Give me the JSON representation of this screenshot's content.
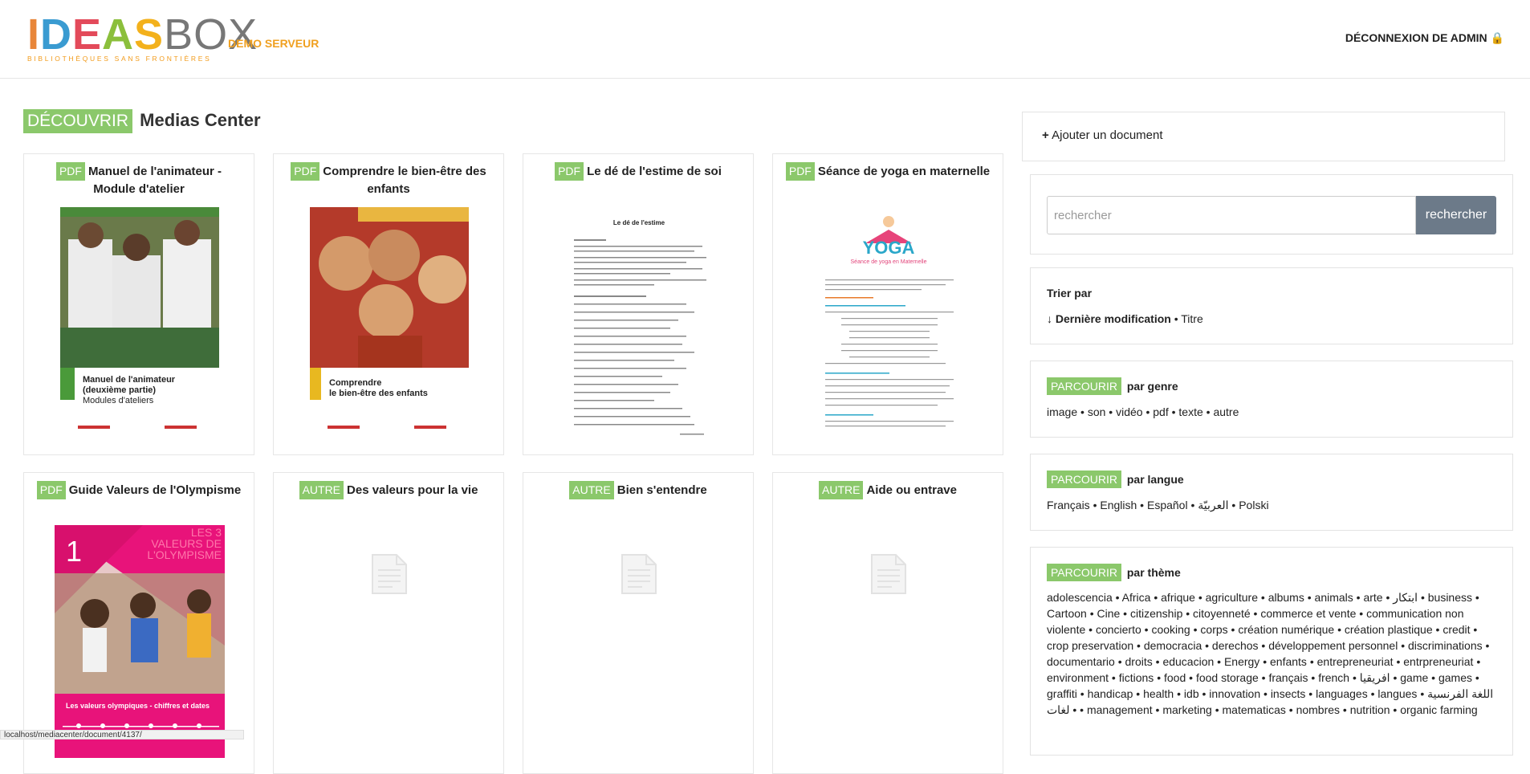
{
  "header": {
    "logo_letters": [
      "I",
      "D",
      "E",
      "A",
      "S"
    ],
    "logo_box": "BOX",
    "logo_tagline": "BIBLIOTHÈQUES SANS FRONTIÈRES",
    "server_name": "DEMO SERVEUR",
    "logout_label": "DÉCONNEXION DE ADMIN",
    "logout_icon": "lock-icon"
  },
  "page": {
    "tag": "DÉCOUVRIR",
    "title": "Medias Center"
  },
  "cards": [
    {
      "type": "PDF",
      "title": "Manuel de l'animateur - Module d'atelier",
      "cover_text_1": "Manuel de l'animateur",
      "cover_text_2": "(deuxième partie)",
      "cover_text_3": "Modules d'ateliers"
    },
    {
      "type": "PDF",
      "title": "Comprendre le bien-être des enfants",
      "cover_text_1": "Comprendre",
      "cover_text_2": "le bien-être des enfants"
    },
    {
      "type": "PDF",
      "title": "Le dé de l'estime de soi",
      "cover_text_1": "Le dé de l'estime"
    },
    {
      "type": "PDF",
      "title": "Séance de yoga en maternelle",
      "cover_text_1": "YOGA",
      "cover_text_2": "Séance de yoga en Maternelle"
    },
    {
      "type": "PDF",
      "title": "Guide Valeurs de l'Olympisme",
      "cover_text_1": "1",
      "cover_text_2": "LES 3",
      "cover_text_3": "VALEURS DE",
      "cover_text_4": "L'OLYMPISME",
      "cover_text_5": "Les valeurs olympiques - chiffres et dates"
    },
    {
      "type": "AUTRE",
      "title": "Des valeurs pour la vie"
    },
    {
      "type": "AUTRE",
      "title": "Bien s'entendre"
    },
    {
      "type": "AUTRE",
      "title": "Aide ou entrave"
    }
  ],
  "sidebar": {
    "add_document": "Ajouter un document",
    "search": {
      "placeholder": "rechercher",
      "button": "rechercher"
    },
    "sort": {
      "title": "Trier par",
      "active": "Dernière modification",
      "other": "Titre"
    },
    "genre": {
      "tag": "PARCOURIR",
      "title": "par genre",
      "items": [
        "image",
        "son",
        "vidéo",
        "pdf",
        "texte",
        "autre"
      ]
    },
    "langue": {
      "tag": "PARCOURIR",
      "title": "par langue",
      "items": [
        "Français",
        "English",
        "Español",
        "العربيّة",
        "Polski"
      ]
    },
    "theme": {
      "tag": "PARCOURIR",
      "title": "par thème",
      "items": [
        "adolescencia",
        "Africa",
        "afrique",
        "agriculture",
        "albums",
        "animals",
        "arte",
        "ابتكار",
        "business",
        "Cartoon",
        "Cine",
        "citizenship",
        "citoyenneté",
        "commerce et vente",
        "communication non violente",
        "concierto",
        "cooking",
        "corps",
        "création numérique",
        "création plastique",
        "credit",
        "crop preservation",
        "democracia",
        "derechos",
        "développement personnel",
        "discriminations",
        "documentario",
        "droits",
        "educacion",
        "Energy",
        "enfants",
        "entrepreneuriat",
        "entrpreneuriat",
        "environment",
        "fictions",
        "food",
        "food storage",
        "français",
        "french",
        "افريقيا",
        "game",
        "games",
        "graffiti",
        "handicap",
        "health",
        "idb",
        "innovation",
        "insects",
        "languages",
        "langues",
        "اللغة الفرنسية",
        "لغات",
        "management",
        "marketing",
        "matematicas",
        "nombres",
        "nutrition",
        "organic farming"
      ]
    }
  },
  "status_bar": "localhost/mediacenter/document/4137/",
  "colors": {
    "accent_green": "#8bc86b",
    "brand_orange": "#f0a020",
    "button_gray": "#6c7a89"
  }
}
